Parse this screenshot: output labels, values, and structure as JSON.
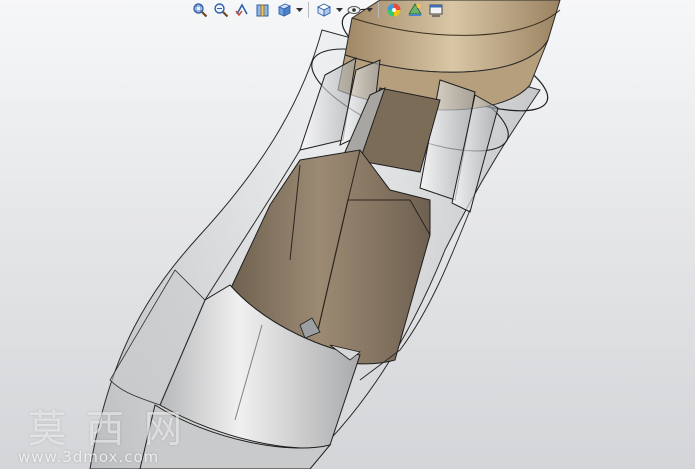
{
  "toolbar": {
    "tools": [
      {
        "icon": "zoom-to-fit-icon"
      },
      {
        "icon": "zoom-to-area-icon"
      },
      {
        "icon": "previous-view-icon"
      },
      {
        "icon": "section-view-icon"
      },
      {
        "icon": "view-orientation-icon",
        "dropdown": true
      },
      {
        "icon": "display-style-icon",
        "dropdown": true
      },
      {
        "icon": "hide-show-items-icon",
        "dropdown": true
      },
      {
        "icon": "edit-appearance-icon"
      },
      {
        "icon": "apply-scene-icon"
      },
      {
        "icon": "view-settings-icon"
      }
    ]
  },
  "model": {
    "outer_shell_color": "#bfc1c2",
    "bronze_color": "#b59f7c",
    "bronze_dark_color": "#7b6c58",
    "steel_color": "#e2e3e4"
  },
  "watermark": {
    "brand": "莫西网",
    "url": "www.3dmox.com"
  }
}
